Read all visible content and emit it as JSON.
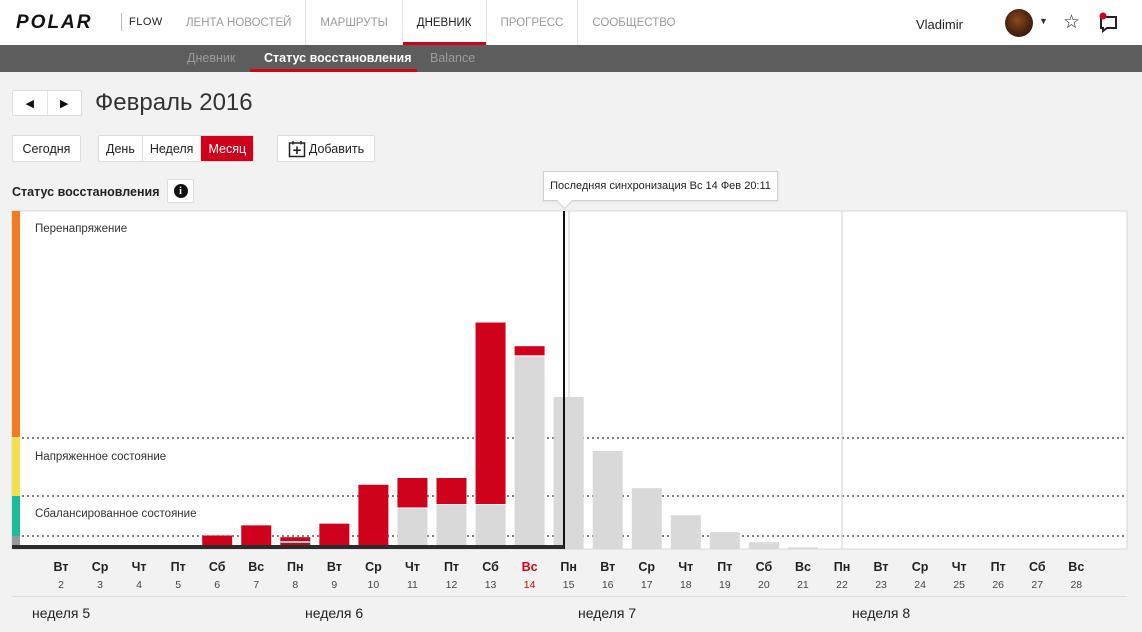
{
  "header": {
    "logo": "POLAR",
    "product": "FLOW",
    "nav": [
      "ЛЕНТА НОВОСТЕЙ",
      "МАРШРУТЫ",
      "ДНЕВНИК",
      "ПРОГРЕСС",
      "СООБЩЕСТВО"
    ],
    "active_nav": "ДНЕВНИК",
    "user_name": "Vladimir"
  },
  "subnav": {
    "items": [
      "Дневник",
      "Статус восстановления",
      "Balance"
    ],
    "active": "Статус восстановления"
  },
  "toolbar": {
    "month_title": "Февраль 2016",
    "today_label": "Сегодня",
    "range_options": [
      "День",
      "Неделя",
      "Месяц"
    ],
    "active_range": "Месяц",
    "add_label": "Добавить"
  },
  "section": {
    "title": "Статус восстановления",
    "info_icon": "i"
  },
  "tooltip": "Последняя синхронизация Вс 14 Фев 20:11",
  "colors": {
    "accent": "#d0021b",
    "overreaching": "#f47b20",
    "strained": "#f4e04d",
    "balanced": "#1abc9c",
    "forecast": "#d9d9d9",
    "nav_bg": "#5d5d5d"
  },
  "chart_data": {
    "type": "bar",
    "zones": [
      "Перенапряжение",
      "Напряженное состояние",
      "Сбалансированное состояние"
    ],
    "days": [
      {
        "dow": "Вт",
        "date": "2",
        "load": 0,
        "forecast": 0
      },
      {
        "dow": "Ср",
        "date": "3",
        "load": 0,
        "forecast": 0
      },
      {
        "dow": "Чт",
        "date": "4",
        "load": 0,
        "forecast": 0
      },
      {
        "dow": "Пт",
        "date": "5",
        "load": 0,
        "forecast": 0
      },
      {
        "dow": "Сб",
        "date": "6",
        "load": 0.04,
        "forecast": 0
      },
      {
        "dow": "Вс",
        "date": "7",
        "load": 0.07,
        "forecast": 0
      },
      {
        "dow": "Пн",
        "date": "8",
        "load": 0.035,
        "forecast": 0
      },
      {
        "dow": "Вт",
        "date": "9",
        "load": 0.075,
        "forecast": 0
      },
      {
        "dow": "Ср",
        "date": "10",
        "load": 0.19,
        "forecast": 0
      },
      {
        "dow": "Чт",
        "date": "11",
        "load": 0.21,
        "forecast": 0.12
      },
      {
        "dow": "Пт",
        "date": "12",
        "load": 0.21,
        "forecast": 0.13
      },
      {
        "dow": "Сб",
        "date": "13",
        "load": 0.67,
        "forecast": 0.13
      },
      {
        "dow": "Вс",
        "date": "14",
        "load": 0.6,
        "forecast": 0.57
      },
      {
        "dow": "Пн",
        "date": "15",
        "load": 0,
        "forecast": 0.45
      },
      {
        "dow": "Вт",
        "date": "16",
        "load": 0,
        "forecast": 0.29
      },
      {
        "dow": "Ср",
        "date": "17",
        "load": 0,
        "forecast": 0.18
      },
      {
        "dow": "Чт",
        "date": "18",
        "load": 0,
        "forecast": 0.1
      },
      {
        "dow": "Пт",
        "date": "19",
        "load": 0,
        "forecast": 0.05
      },
      {
        "dow": "Сб",
        "date": "20",
        "load": 0,
        "forecast": 0.02
      },
      {
        "dow": "Вс",
        "date": "21",
        "load": 0,
        "forecast": 0.005
      },
      {
        "dow": "Пн",
        "date": "22",
        "load": 0,
        "forecast": 0
      },
      {
        "dow": "Вт",
        "date": "23",
        "load": 0,
        "forecast": 0
      },
      {
        "dow": "Ср",
        "date": "24",
        "load": 0,
        "forecast": 0
      },
      {
        "dow": "Чт",
        "date": "25",
        "load": 0,
        "forecast": 0
      },
      {
        "dow": "Пт",
        "date": "26",
        "load": 0,
        "forecast": 0
      },
      {
        "dow": "Сб",
        "date": "27",
        "load": 0,
        "forecast": 0
      },
      {
        "dow": "Вс",
        "date": "28",
        "load": 0,
        "forecast": 0
      }
    ],
    "today": "14",
    "weeks": [
      "неделя 5",
      "неделя 6",
      "неделя 7",
      "неделя 8"
    ]
  }
}
